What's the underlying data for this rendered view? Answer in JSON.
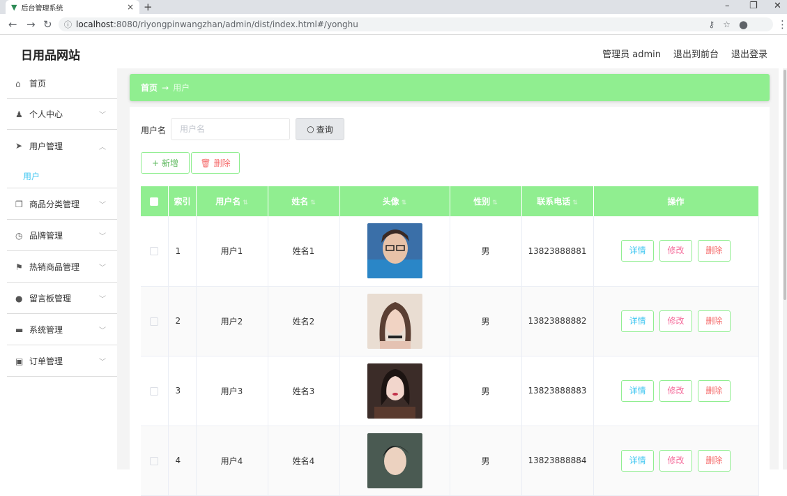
{
  "browser": {
    "tab_title": "后台管理系统",
    "url_host": "localhost",
    "url_rest": ":8080/riyongpinwangzhan/admin/dist/index.html#/yonghu"
  },
  "header": {
    "logo": "日用品网站",
    "admin": "管理员 admin",
    "to_front": "退出到前台",
    "logout": "退出登录"
  },
  "sidebar": {
    "items": [
      {
        "label": "首页",
        "icon": "home-icon"
      },
      {
        "label": "个人中心",
        "icon": "user-icon"
      },
      {
        "label": "用户管理",
        "icon": "send-icon"
      },
      {
        "label": "商品分类管理",
        "icon": "copy-icon"
      },
      {
        "label": "品牌管理",
        "icon": "clock-icon"
      },
      {
        "label": "热销商品管理",
        "icon": "flag-icon"
      },
      {
        "label": "留言板管理",
        "icon": "pin-icon"
      },
      {
        "label": "系统管理",
        "icon": "briefcase-icon"
      },
      {
        "label": "订单管理",
        "icon": "clipboard-icon"
      }
    ],
    "sub_active": "用户"
  },
  "breadcrumb": {
    "home": "首页",
    "arrow": "→",
    "current": "用户"
  },
  "search": {
    "label": "用户名",
    "placeholder": "用户名",
    "button": "查询"
  },
  "actions": {
    "add": "新增",
    "delete": "删除"
  },
  "table": {
    "columns": [
      "索引",
      "用户名",
      "姓名",
      "头像",
      "性别",
      "联系电话",
      "操作"
    ],
    "rows": [
      {
        "index": "1",
        "username": "用户1",
        "name": "姓名1",
        "gender": "男",
        "phone": "13823888881"
      },
      {
        "index": "2",
        "username": "用户2",
        "name": "姓名2",
        "gender": "男",
        "phone": "13823888882"
      },
      {
        "index": "3",
        "username": "用户3",
        "name": "姓名3",
        "gender": "男",
        "phone": "13823888883"
      },
      {
        "index": "4",
        "username": "用户4",
        "name": "姓名4",
        "gender": "男",
        "phone": "13823888884"
      }
    ],
    "ops": {
      "detail": "详情",
      "edit": "修改",
      "delete": "删除"
    }
  },
  "colors": {
    "accent": "#90ee90",
    "link": "#3fc6f1",
    "danger": "#f56c6c"
  }
}
